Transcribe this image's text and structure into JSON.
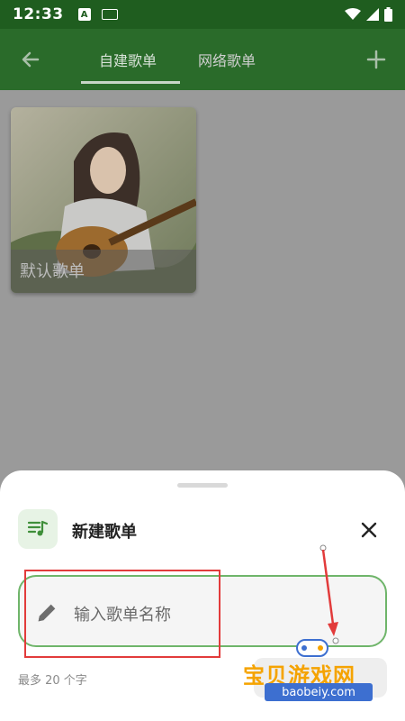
{
  "status_bar": {
    "time": "12:33",
    "badge": "A"
  },
  "tabs": [
    {
      "label": "自建歌单",
      "active": true
    },
    {
      "label": "网络歌单",
      "active": false
    }
  ],
  "playlists": [
    {
      "title": "默认歌单"
    }
  ],
  "sheet": {
    "title": "新建歌单",
    "input": {
      "placeholder": "输入歌单名称",
      "value": ""
    },
    "hint": "最多 20 个字"
  },
  "watermark": {
    "text": "宝贝游戏网",
    "url": "baobeiy.com"
  },
  "colors": {
    "app_bar": "#2a6b2a",
    "accent": "#6fb56a",
    "annotation": "#e23b3b"
  },
  "icons": {
    "back": "arrow-left-icon",
    "add": "plus-icon",
    "playlist": "music-playlist-icon",
    "close": "close-icon",
    "edit": "pencil-icon"
  }
}
